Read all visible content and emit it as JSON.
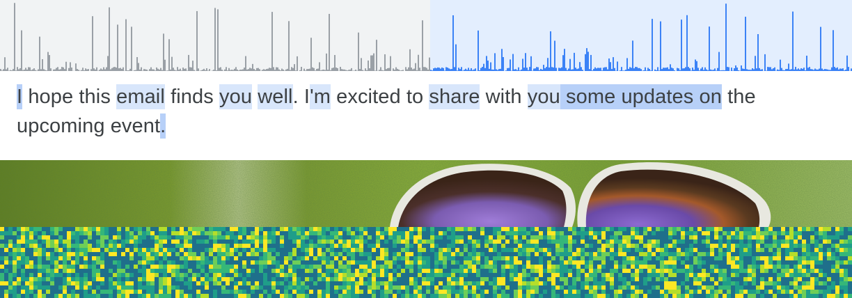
{
  "waveform": {
    "played_color": "#9aa0a6",
    "played_bg": "#f1f3f4",
    "unplayed_color": "#3b82f6",
    "unplayed_bg": "#e3eefe",
    "progress": 0.505
  },
  "transcript": {
    "text_color": "#3c4043",
    "highlight_light": "#d8e6fb",
    "highlight_mid": "#b7d0f8",
    "tokens": [
      {
        "t": "I",
        "hl": "mid"
      },
      {
        "t": " hope this ",
        "hl": ""
      },
      {
        "t": "email",
        "hl": "light"
      },
      {
        "t": " finds ",
        "hl": ""
      },
      {
        "t": "you",
        "hl": "light"
      },
      {
        "t": " ",
        "hl": ""
      },
      {
        "t": "well",
        "hl": "light"
      },
      {
        "t": ". I",
        "hl": ""
      },
      {
        "t": "'m",
        "hl": "light"
      },
      {
        "t": " excited to ",
        "hl": ""
      },
      {
        "t": "share",
        "hl": "light"
      },
      {
        "t": " with ",
        "hl": ""
      },
      {
        "t": "you",
        "hl": "light"
      },
      {
        "t": " some updates on",
        "hl": "mid"
      },
      {
        "t": " the upcoming event",
        "hl": ""
      },
      {
        "t": ".",
        "hl": "mid"
      }
    ]
  },
  "image": {
    "subject": "butterfly-photo"
  },
  "spectrogram": {
    "colormap": [
      "#1f6f8b",
      "#1f9e89",
      "#35b779",
      "#6ece58",
      "#b5de2b",
      "#fde725"
    ]
  }
}
